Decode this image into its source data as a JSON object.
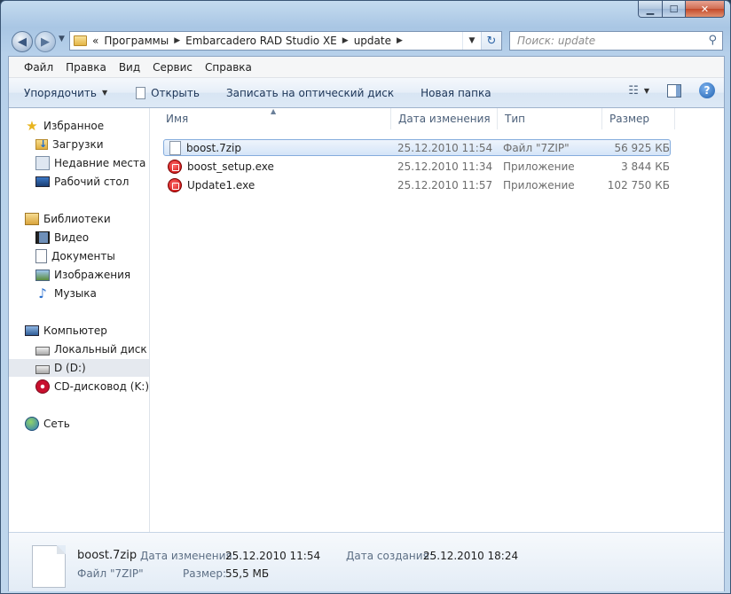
{
  "window": {
    "min_icon": "minimize-icon",
    "max_icon": "maximize-icon",
    "close_icon": "close-icon"
  },
  "address": {
    "prefix": "«",
    "crumbs": [
      "Программы",
      "Embarcadero RAD Studio XE",
      "update"
    ]
  },
  "search": {
    "placeholder": "Поиск: update"
  },
  "menu": [
    "Файл",
    "Правка",
    "Вид",
    "Сервис",
    "Справка"
  ],
  "toolbar": {
    "organize": "Упорядочить",
    "open": "Открыть",
    "burn": "Записать на оптический диск",
    "new_folder": "Новая папка"
  },
  "nav": {
    "favorites": "Избранное",
    "downloads": "Загрузки",
    "recent": "Недавние места",
    "desktop": "Рабочий стол",
    "libraries": "Библиотеки",
    "video": "Видео",
    "documents": "Документы",
    "images": "Изображения",
    "music": "Музыка",
    "computer": "Компьютер",
    "local_disk": "Локальный диск (C",
    "d_drive": "D (D:)",
    "cd_drive": "CD-дисковод (K:) M",
    "network": "Сеть"
  },
  "columns": {
    "name": "Имя",
    "modified": "Дата изменения",
    "type": "Тип",
    "size": "Размер"
  },
  "files": [
    {
      "name": "boost.7zip",
      "modified": "25.12.2010 11:54",
      "type": "Файл \"7ZIP\"",
      "size": "56 925 КБ",
      "icon": "zip-file-icon"
    },
    {
      "name": "boost_setup.exe",
      "modified": "25.12.2010 11:34",
      "type": "Приложение",
      "size": "3 844 КБ",
      "icon": "exe-icon"
    },
    {
      "name": "Update1.exe",
      "modified": "25.12.2010 11:57",
      "type": "Приложение",
      "size": "102 750 КБ",
      "icon": "exe-icon"
    }
  ],
  "details": {
    "filename": "boost.7zip",
    "filetype": "Файл \"7ZIP\"",
    "modified_label": "Дата изменения:",
    "modified": "25.12.2010 11:54",
    "created_label": "Дата создания:",
    "created": "25.12.2010 18:24",
    "size_label": "Размер:",
    "size": "55,5 МБ"
  }
}
